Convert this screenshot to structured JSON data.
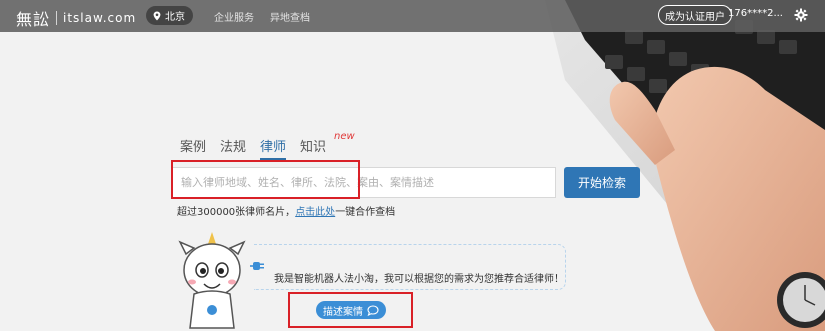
{
  "header": {
    "logo_mark": "無訟",
    "logo_domain": "itslaw.com",
    "city": "北京",
    "nav": [
      "企业服务",
      "异地查档"
    ],
    "verify_label": "成为认证用户",
    "user_phone": "176****2..."
  },
  "search": {
    "tabs": [
      {
        "label": "案例",
        "active": false
      },
      {
        "label": "法规",
        "active": false
      },
      {
        "label": "律师",
        "active": true
      },
      {
        "label": "知识",
        "active": false
      }
    ],
    "new_badge": "new",
    "placeholder": "输入律师地域、姓名、律所、法院、案由、案情描述",
    "button_label": "开始检索",
    "hint_prefix": "超过300000张律师名片，",
    "hint_link": "点击此处",
    "hint_suffix": "一键合作查档"
  },
  "robot": {
    "message": "我是智能机器人法小淘，我可以根据您的需求为您推荐合适律师！",
    "button_label": "描述案情"
  },
  "colors": {
    "accent": "#2f76b5",
    "highlight_box": "#d92027",
    "topbar": "#5f5f5f",
    "new_badge": "#e03a3a"
  },
  "icons": [
    "location-pin-icon",
    "gear-icon",
    "plug-icon",
    "chat-bubble-icon"
  ]
}
